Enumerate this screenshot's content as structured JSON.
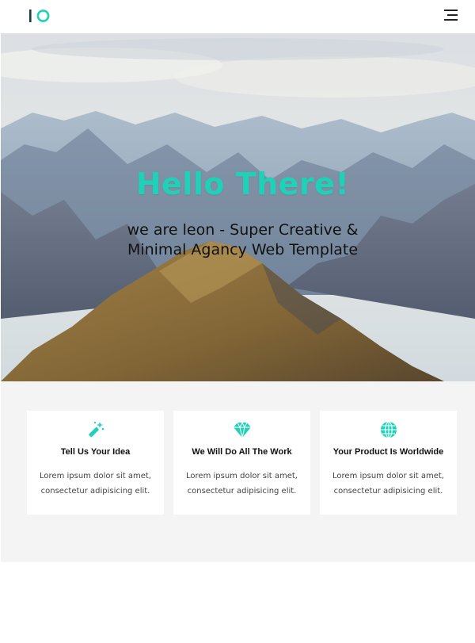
{
  "brand": {
    "logo_icon": "io-logo-icon",
    "accent_color": "#1fd1b6"
  },
  "header": {
    "menu_icon": "hamburger-menu-icon"
  },
  "hero": {
    "title": "Hello There!",
    "subtitle_line1": "we are leon - Super Creative &",
    "subtitle_line2": "Minimal Agancy Web Template",
    "background": "mountain-landscape-image"
  },
  "features": [
    {
      "icon": "magic-wand-icon",
      "title": "Tell Us Your Idea",
      "text": "Lorem ipsum dolor sit amet, consectetur adipisicing elit."
    },
    {
      "icon": "diamond-icon",
      "title": "We Will Do All The Work",
      "text": "Lorem ipsum dolor sit amet, consectetur adipisicing elit."
    },
    {
      "icon": "globe-icon",
      "title": "Your Product Is Worldwide",
      "text": "Lorem ipsum dolor sit amet, consectetur adipisicing elit."
    }
  ]
}
